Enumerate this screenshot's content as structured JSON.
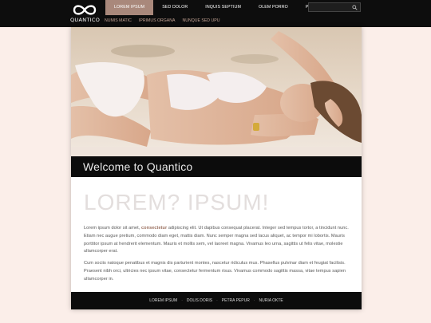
{
  "brand": {
    "name": "QUANTICO"
  },
  "nav": {
    "main": [
      "LOREM IPSUM",
      "SED DOLOR",
      "INQUIS SEPTIUM",
      "OLEM PORRO",
      "PULLUS IMPOUS"
    ],
    "sub": [
      "NUMIS MATIC",
      "IPRIMUS ORGANA",
      "NUNQUE SED UPU"
    ]
  },
  "search": {
    "placeholder": ""
  },
  "hero": {
    "welcome": "Welcome to Quantico"
  },
  "content": {
    "headline": "LOREM? IPSUM!",
    "p1_a": "Lorem ipsum dolor sit amet, ",
    "p1_link": "consectetur",
    "p1_b": " adipiscing elit. Ut dapibus consequat placerat. Integer sed tempus tortor, a tincidunt nunc. Etiam nec augue pretium, commodo diam eget, mattis diam. Nunc semper magna sed lacus aliquet, ac tempor mi lobortis. Mauris porttitor ipsum at hendrerit elementum. Mauris et mollis sem, vel laoreet magna. Vivamus leo urna, sagittis ut felis vitae, molestie ullamcorper erat.",
    "p2": "Cum sociis natoque penatibus et magnis dis parturient montes, nascetur ridiculus mus. Phasellus pulvinar diam et feugiat facilisis. Praesent nibh orci, ultricies nec ipsum vitae, consectetur fermentum risus. Vivamus commodo sagittis massa, vitae tempus sapien ullamcorper in."
  },
  "footer": {
    "links": [
      "LOREM IPSUM",
      "DOLIS DORIS",
      "PETRA PEPUR",
      "NURIA OKTE"
    ]
  },
  "colors": {
    "accent": "#a9887b",
    "subnav": "#c4a394",
    "bg": "#fbeee9",
    "bar": "#0c0c0c"
  }
}
